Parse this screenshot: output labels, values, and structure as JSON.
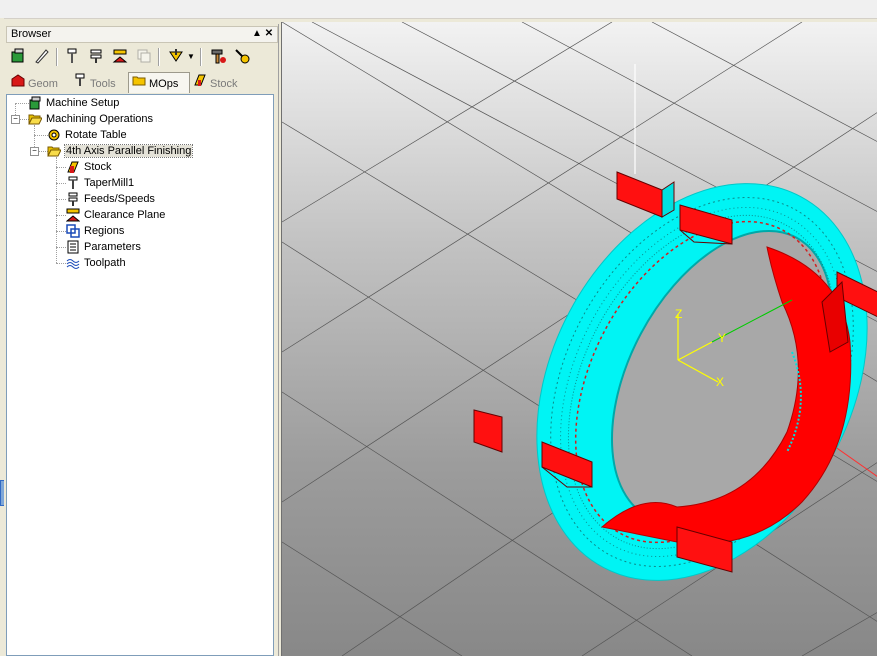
{
  "browser": {
    "title": "Browser",
    "pin_icon": "pin-icon",
    "close_icon": "close-icon",
    "toolbar": [
      "machine-setup-icon",
      "edit-icon",
      "tool-icon",
      "feeds-icon",
      "clearance-icon",
      "copy-icon",
      "tool-dropdown-icon",
      "dropdown-arrow-icon",
      "hammer-icon",
      "generate-icon"
    ],
    "tabs": [
      {
        "label": "Geom",
        "icon": "geom-icon"
      },
      {
        "label": "Tools",
        "icon": "tools-icon"
      },
      {
        "label": "MOps",
        "icon": "mops-icon"
      },
      {
        "label": "Stock",
        "icon": "stock-icon"
      }
    ],
    "tree": [
      {
        "label": "Machine Setup",
        "icon": "machine-setup-icon"
      },
      {
        "label": "Machining Operations",
        "icon": "folder-open-icon"
      },
      {
        "label": "Rotate Table",
        "icon": "rotate-table-icon"
      },
      {
        "label": "4th Axis Parallel Finishing",
        "icon": "folder-open-icon"
      },
      {
        "label": "Stock",
        "icon": "stock-icon"
      },
      {
        "label": "TaperMill1",
        "icon": "tool-icon"
      },
      {
        "label": "Feeds/Speeds",
        "icon": "feeds-icon"
      },
      {
        "label": "Clearance Plane",
        "icon": "clearance-icon"
      },
      {
        "label": "Regions",
        "icon": "regions-icon"
      },
      {
        "label": "Parameters",
        "icon": "parameters-icon"
      },
      {
        "label": "Toolpath",
        "icon": "toolpath-icon"
      }
    ]
  },
  "viewport": {
    "axes": {
      "z": "Z",
      "y": "Y",
      "x": "X"
    },
    "colors": {
      "toolpath": "#00ffff",
      "part": "#ff0000",
      "axis_x": "#ff3030",
      "axis_y": "#00cc00",
      "axis_z": "#ffff00"
    }
  }
}
